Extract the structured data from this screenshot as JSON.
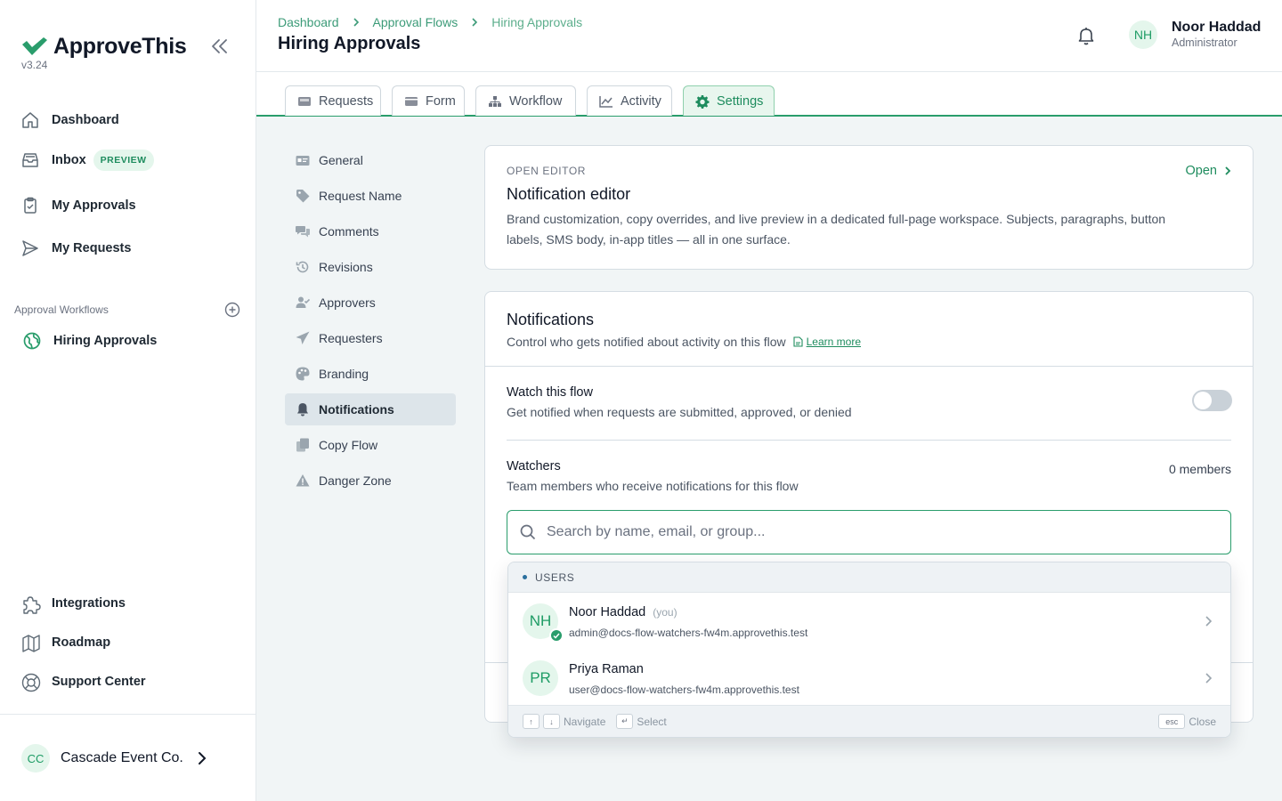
{
  "app": {
    "name": "ApproveThis",
    "version": "v3.24"
  },
  "sidebar": {
    "nav": [
      {
        "label": "Dashboard",
        "icon": "home-icon"
      },
      {
        "label": "Inbox",
        "icon": "inbox-icon",
        "badge": "PREVIEW"
      },
      {
        "label": "My Approvals",
        "icon": "clipboard-check-icon"
      },
      {
        "label": "My Requests",
        "icon": "send-icon"
      }
    ],
    "section_label": "Approval Workflows",
    "workflows": [
      {
        "label": "Hiring Approvals",
        "icon": "globe-icon"
      }
    ],
    "bottom": [
      {
        "label": "Integrations",
        "icon": "puzzle-icon"
      },
      {
        "label": "Roadmap",
        "icon": "map-icon"
      },
      {
        "label": "Support Center",
        "icon": "lifebuoy-icon"
      }
    ],
    "org": {
      "initials": "CC",
      "name": "Cascade Event Co."
    }
  },
  "header": {
    "breadcrumbs": [
      "Dashboard",
      "Approval Flows",
      "Hiring Approvals"
    ],
    "title": "Hiring Approvals",
    "user": {
      "initials": "NH",
      "name": "Noor Haddad",
      "role": "Administrator"
    }
  },
  "tabs": [
    {
      "label": "Requests",
      "icon": "tray-icon"
    },
    {
      "label": "Form",
      "icon": "form-icon"
    },
    {
      "label": "Workflow",
      "icon": "sitemap-icon"
    },
    {
      "label": "Activity",
      "icon": "chart-line-icon"
    },
    {
      "label": "Settings",
      "icon": "gear-icon",
      "active": true
    }
  ],
  "settings_menu": [
    {
      "label": "General",
      "icon": "id-card-icon"
    },
    {
      "label": "Request Name",
      "icon": "tag-icon"
    },
    {
      "label": "Comments",
      "icon": "comments-icon"
    },
    {
      "label": "Revisions",
      "icon": "history-icon"
    },
    {
      "label": "Approvers",
      "icon": "user-check-icon"
    },
    {
      "label": "Requesters",
      "icon": "paper-plane-icon"
    },
    {
      "label": "Branding",
      "icon": "palette-icon"
    },
    {
      "label": "Notifications",
      "icon": "bell-icon",
      "active": true
    },
    {
      "label": "Copy Flow",
      "icon": "copy-icon"
    },
    {
      "label": "Danger Zone",
      "icon": "warning-icon"
    }
  ],
  "editor_card": {
    "eyebrow": "OPEN EDITOR",
    "title": "Notification editor",
    "description": "Brand customization, copy overrides, and live preview in a dedicated full-page workspace. Subjects, paragraphs, button labels, SMS body, in-app titles — all in one surface.",
    "open_label": "Open"
  },
  "notifications": {
    "title": "Notifications",
    "subtitle": "Control who gets notified about activity on this flow",
    "learn_more": "Learn more",
    "watch": {
      "title": "Watch this flow",
      "description": "Get notified when requests are submitted, approved, or denied",
      "enabled": false
    },
    "watchers": {
      "title": "Watchers",
      "description": "Team members who receive notifications for this flow",
      "count": "0 members"
    },
    "search": {
      "placeholder": "Search by name, email, or group...",
      "value": ""
    }
  },
  "dropdown": {
    "group_label": "USERS",
    "users": [
      {
        "initials": "NH",
        "name": "Noor Haddad",
        "tag": "(you)",
        "email": "admin@docs-flow-watchers-fw4m.approvethis.test",
        "verified": true
      },
      {
        "initials": "PR",
        "name": "Priya Raman",
        "tag": "",
        "email": "user@docs-flow-watchers-fw4m.approvethis.test",
        "verified": false
      }
    ],
    "footer": {
      "nav_keys": [
        "↑",
        "↓"
      ],
      "navigate": "Navigate",
      "select_key": "↵",
      "select": "Select",
      "close_key": "esc",
      "close": "Close"
    }
  },
  "colors": {
    "accent": "#2a9d6c",
    "accent_light": "#e4f6ec",
    "sidebar_bg": "#ffffff",
    "content_bg": "#f1f5f6"
  }
}
